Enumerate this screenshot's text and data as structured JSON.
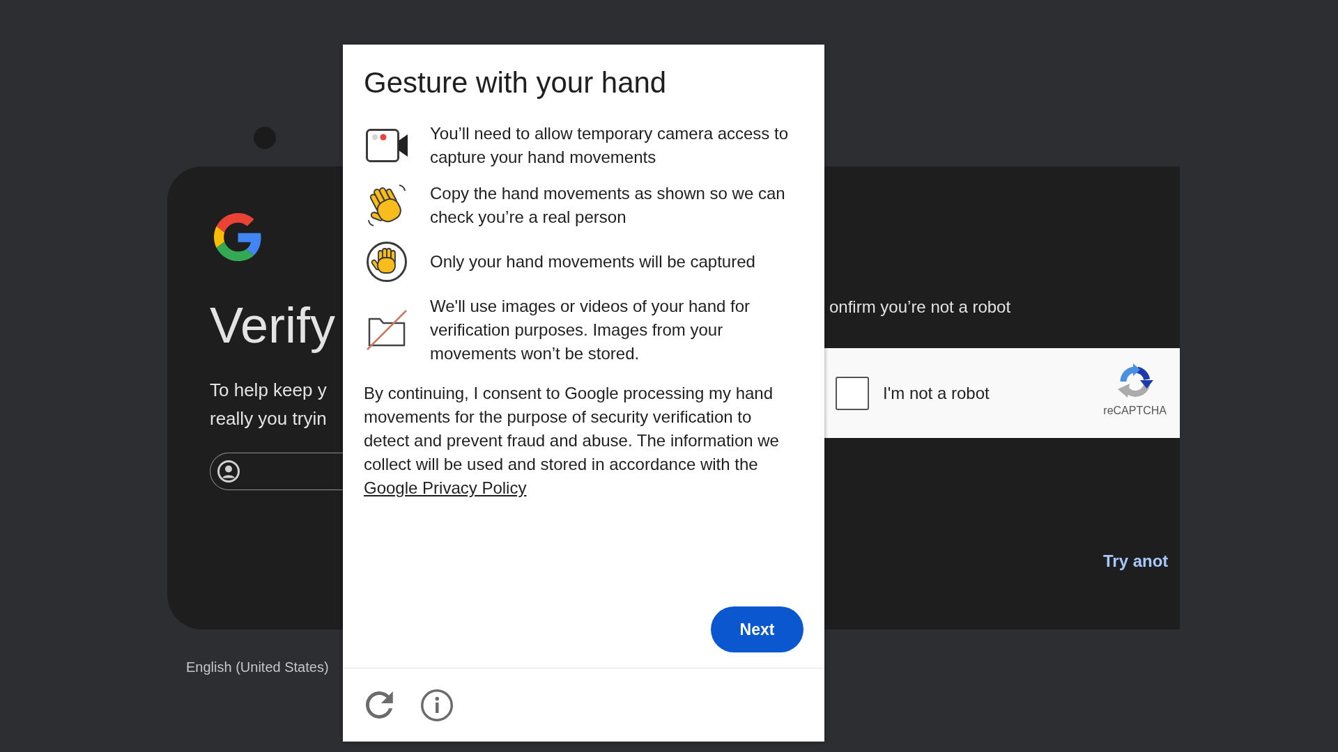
{
  "sign_in_card": {
    "heading": "Verify",
    "description_lines": [
      "To help keep y",
      "really you tryin"
    ],
    "robot_prompt": "onfirm you’re not a robot",
    "recaptcha": {
      "checked": false,
      "label": "I'm not a robot",
      "brand": "reCAPTCHA"
    },
    "link": "Try anot"
  },
  "language": "English (United States)",
  "dialog": {
    "title": "Gesture with your hand",
    "instructions": [
      "You’ll need to allow temporary camera access to capture your hand movements",
      "Copy the hand movements as shown so we can check you’re a real person",
      "Only your hand movements will be captured",
      "We'll use images or videos of your hand for verification purposes. Images from your movements won’t be stored."
    ],
    "consent": {
      "text": "By continuing, I consent to Google processing my hand movements for the purpose of security verification to detect and prevent fraud and abuse. The information we collect will be used and stored in accordance with the",
      "link": "Google Privacy Policy"
    },
    "next_button": "Next"
  }
}
